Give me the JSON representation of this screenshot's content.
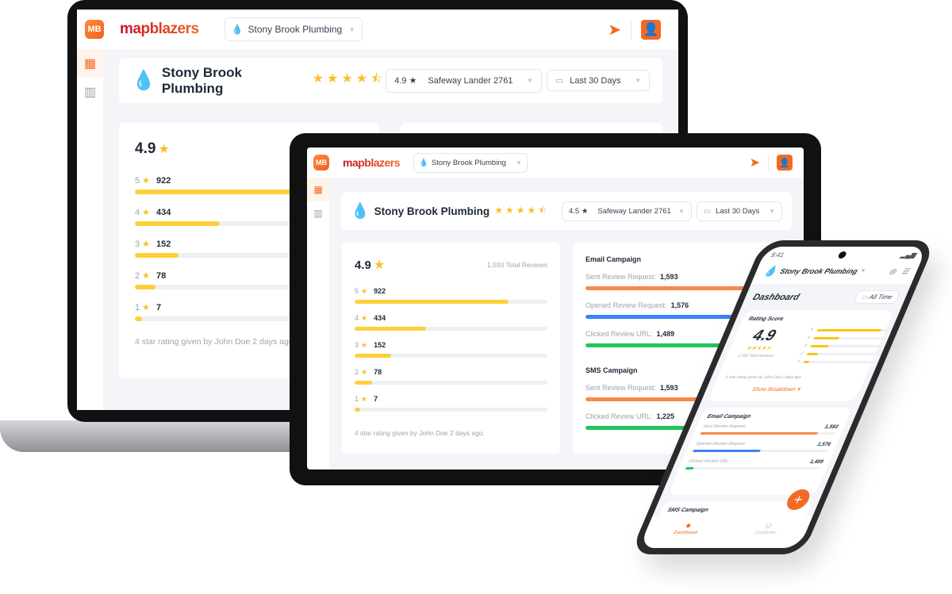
{
  "app": {
    "logo_text": "mapblazers",
    "logo_badge": "MB",
    "business_selector": "Stony Brook Plumbing"
  },
  "colors": {
    "accent": "#f26a21",
    "star": "#fbbf24",
    "email_sent": "#f68a4a",
    "email_opened": "#3b82f6",
    "email_clicked": "#22c55e"
  },
  "icons": {
    "send": "paper-plane-icon",
    "user": "user-icon",
    "dashboard": "dashboard-icon",
    "building": "building-icon",
    "calendar": "calendar-icon",
    "drop": "water-drop-logo-icon"
  },
  "laptop": {
    "business_name": "Stony Brook Plumbing",
    "stars": "★★★★⯪",
    "location_rating": "4.9 ★",
    "location": "Safeway Lander 2761",
    "date_range": "Last 30 Days",
    "rating": "4.9",
    "total_reviews": "1,593 Total Reviews",
    "breakdown": [
      {
        "star": "5",
        "count": "922",
        "fill": 0.8
      },
      {
        "star": "4",
        "count": "434",
        "fill": 0.37
      },
      {
        "star": "3",
        "count": "152",
        "fill": 0.19
      },
      {
        "star": "2",
        "count": "78",
        "fill": 0.09
      },
      {
        "star": "1",
        "count": "7",
        "fill": 0.03
      }
    ],
    "last_review": "4 star rating given by John Doe 2 days ago."
  },
  "tablet": {
    "business_name": "Stony Brook Plumbing",
    "stars": "★★★★⯪",
    "location_rating": "4.5 ★",
    "location": "Safeway Lander 2761",
    "date_range": "Last 30 Days",
    "rating": "4.9",
    "total_reviews": "1,593 Total Reviews",
    "breakdown": [
      {
        "star": "5",
        "count": "922",
        "fill": 0.8
      },
      {
        "star": "4",
        "count": "434",
        "fill": 0.37
      },
      {
        "star": "3",
        "count": "152",
        "fill": 0.19
      },
      {
        "star": "2",
        "count": "78",
        "fill": 0.09
      },
      {
        "star": "1",
        "count": "7",
        "fill": 0.03
      }
    ],
    "last_review": "4 star rating given by John Doe 2 days ago.",
    "email": {
      "title": "Email Campaign",
      "rows": [
        {
          "label": "Sent Review Request:",
          "value": "1,593",
          "fill": 1.0
        },
        {
          "label": "Opened Review Request:",
          "value": "1,576",
          "fill": 0.99
        },
        {
          "label": "Clicked Review URL:",
          "value": "1,489",
          "fill": 0.93
        }
      ]
    },
    "sms": {
      "title": "SMS Campaign",
      "rows": [
        {
          "label": "Sent Review Request:",
          "value": "1,593",
          "fill": 1.0
        },
        {
          "label": "Clicked Review URL:",
          "value": "1,225",
          "fill": 0.77
        }
      ]
    }
  },
  "phone": {
    "time": "9:41",
    "business_name": "Stony Brook Plumbing",
    "page_title": "Dashboard",
    "date_range": "All Time",
    "rating_title": "Rating Score",
    "rating": "4.9",
    "stars": "★★★★⯪",
    "total_reviews": "1,593 Total Reviews",
    "breakdown": [
      {
        "star": "5",
        "fill": 0.88
      },
      {
        "star": "4",
        "fill": 0.35
      },
      {
        "star": "3",
        "fill": 0.25
      },
      {
        "star": "2",
        "fill": 0.15
      },
      {
        "star": "1",
        "fill": 0.08
      }
    ],
    "last_review": "4 star rating given by John Doe 2 days ago",
    "show_breakdown": "Show Breakdown ▾",
    "email": {
      "title": "Email Campaign",
      "rows": [
        {
          "label": "Sent Review Request",
          "value": "1,593",
          "fill": 0.87
        },
        {
          "label": "Opened Review Request:",
          "value": "1,576",
          "fill": 0.5
        },
        {
          "label": "Clicked Review URL:",
          "value": "1,489",
          "fill": 0.06
        }
      ]
    },
    "sms_title": "SMS Campaign",
    "fab": "+",
    "nav": [
      {
        "label": "Dashboard"
      },
      {
        "label": "Customer"
      }
    ]
  }
}
